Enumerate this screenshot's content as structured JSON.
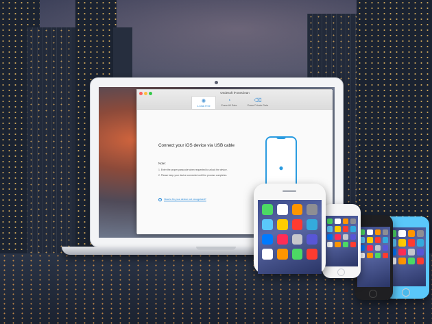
{
  "app": {
    "title": "Ondesoft iFoneClean",
    "tabs": [
      {
        "label": "1-Click Free",
        "icon": "sparkle-icon",
        "active": true
      },
      {
        "label": "Erase All Data",
        "icon": "erase-icon",
        "active": false
      },
      {
        "label": "Erase Private Data",
        "icon": "private-data-icon",
        "active": false
      }
    ],
    "heading": "Connect your iOS device via USB cable",
    "note_title": "Note:",
    "notes": [
      "1. Enter the proper passcode when requested to unlock the device.",
      "2. Please keep your device connected until the process completes."
    ],
    "help_link": "How to fix your device not recognized?",
    "device_icon": "apple-logo-icon"
  },
  "colors": {
    "accent": "#2a9be0",
    "link": "#2a8ad8",
    "window_bg": "#fafafa"
  },
  "phone_app_colors": [
    "#4cd964",
    "#ffffff",
    "#ff9500",
    "#8e8e93",
    "#5ac8fa",
    "#ffcc00",
    "#ff3b30",
    "#34aadc",
    "#007aff",
    "#ff2d55",
    "#c7c7cc",
    "#5856d6",
    "#ffffff",
    "#ff9500",
    "#4cd964",
    "#ff3b30"
  ]
}
